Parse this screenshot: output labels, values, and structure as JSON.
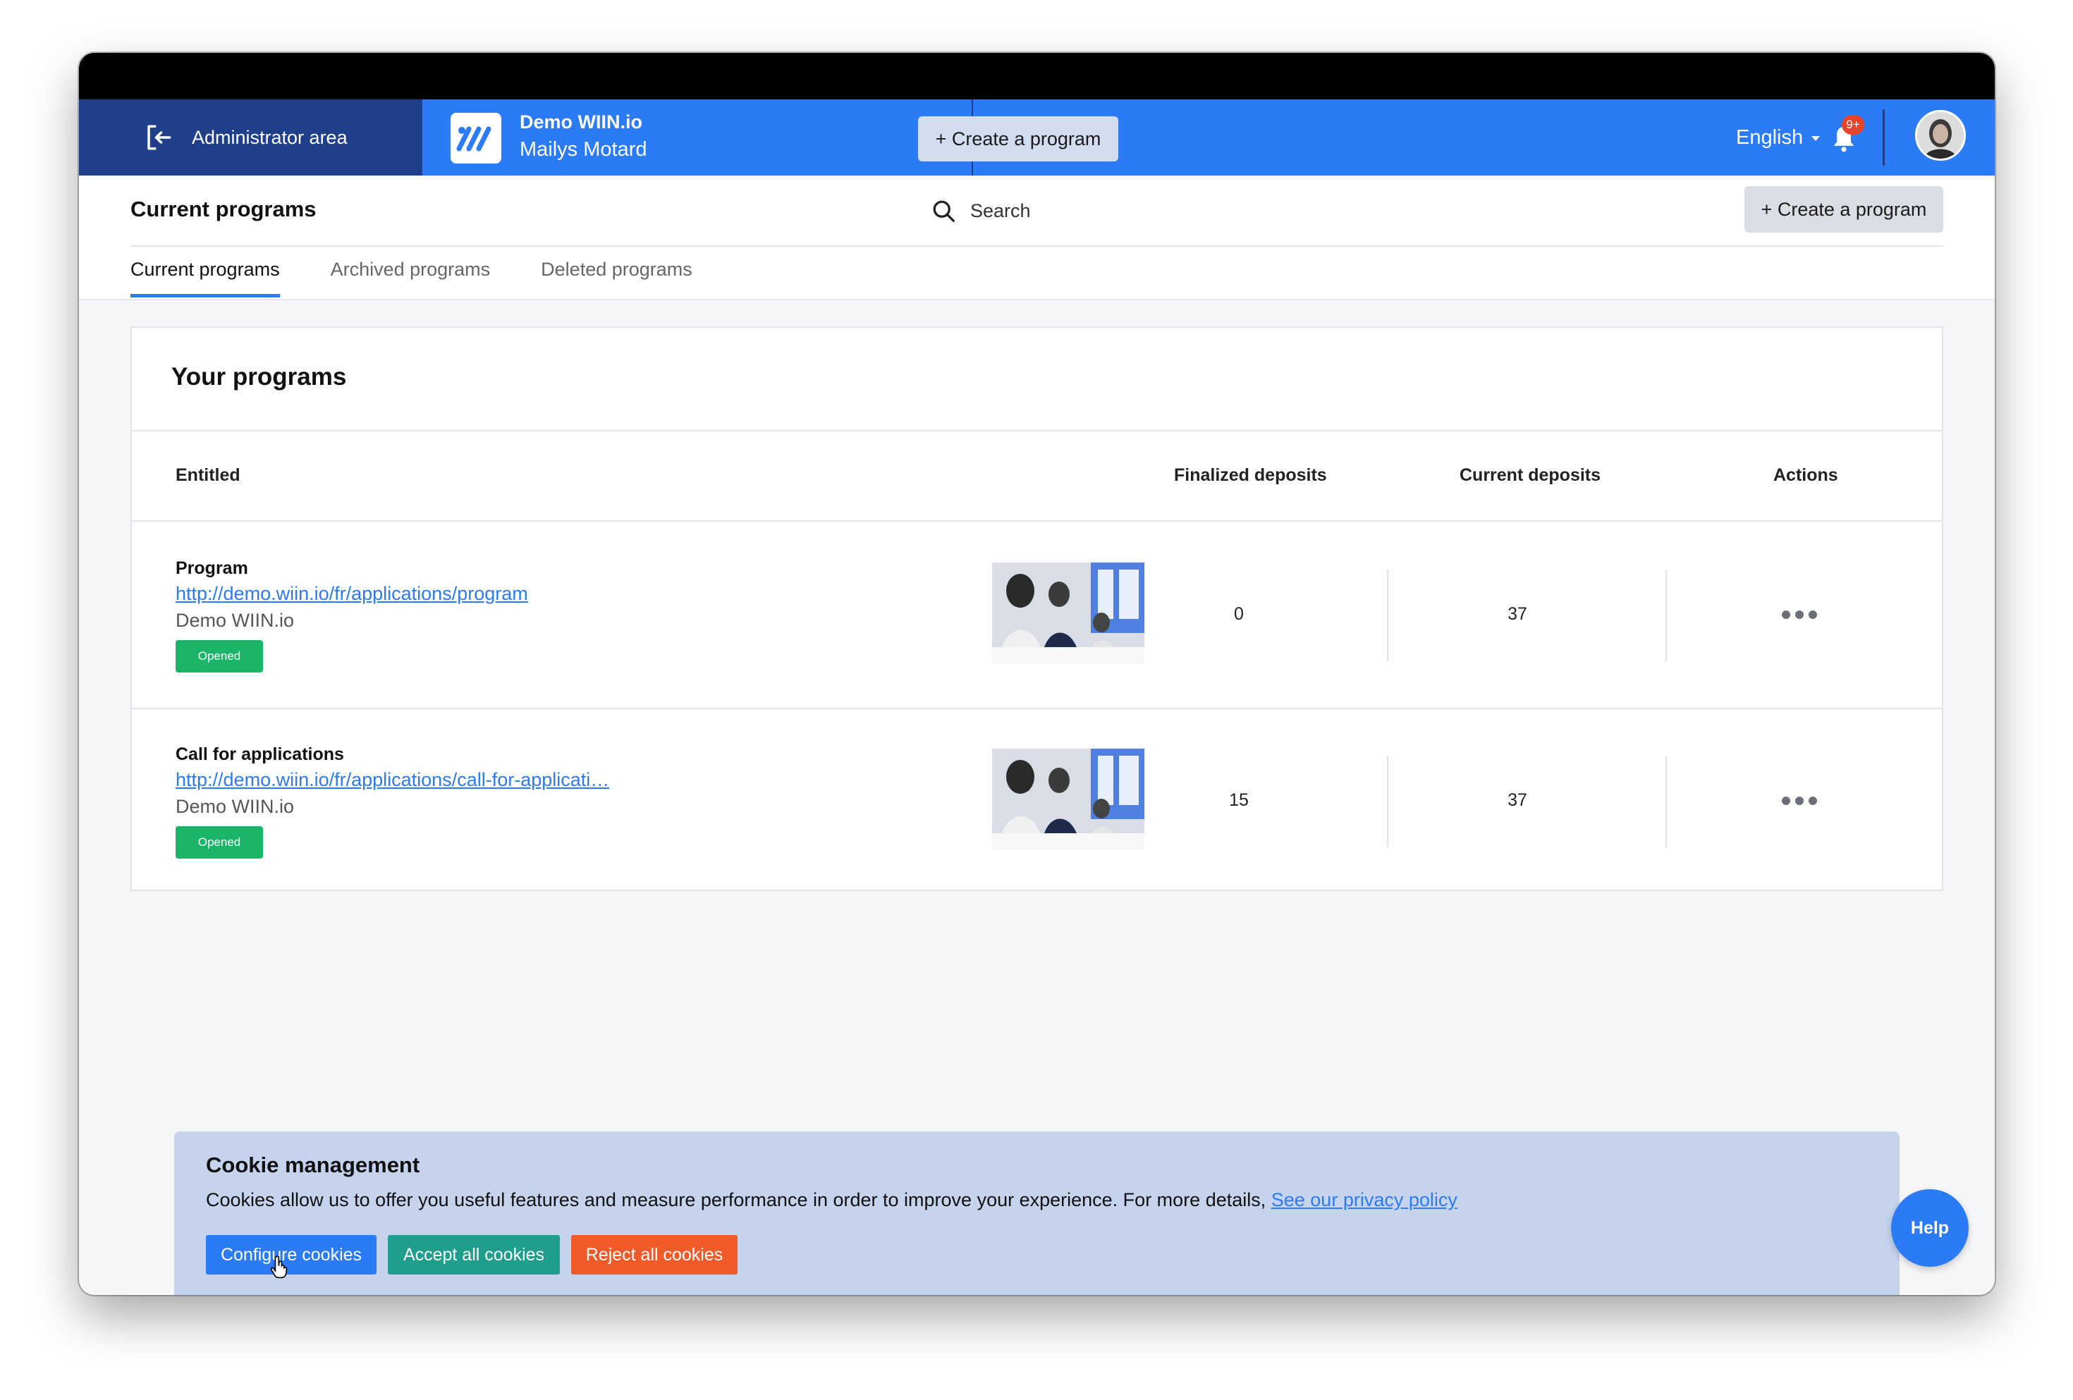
{
  "topnav": {
    "admin_label": "Administrator area",
    "org_name": "Demo WIIN.io",
    "org_user": "Mailys Motard",
    "create_label": "+ Create a program",
    "language": "English",
    "notification_count": "9+",
    "icons": [
      "exit-icon",
      "wiin-logo",
      "chevron-down-icon",
      "bell-icon",
      "avatar"
    ]
  },
  "subheader": {
    "title": "Current programs",
    "search_placeholder": "Search",
    "create_label": "+ Create a program",
    "tabs": [
      {
        "label": "Current programs",
        "active": true
      },
      {
        "label": "Archived programs",
        "active": false
      },
      {
        "label": "Deleted programs",
        "active": false
      }
    ]
  },
  "programs": {
    "title": "Your programs",
    "columns": {
      "entitled": "Entitled",
      "finalized": "Finalized deposits",
      "current": "Current deposits",
      "actions": "Actions"
    },
    "rows": [
      {
        "name": "Program",
        "link": "http://demo.wiin.io/fr/applications/program",
        "org": "Demo WIIN.io",
        "status": "Opened",
        "finalized": "0",
        "current": "37"
      },
      {
        "name": "Call for applications",
        "link": "http://demo.wiin.io/fr/applications/call-for-applicati…",
        "org": "Demo WIIN.io",
        "status": "Opened",
        "finalized": "15",
        "current": "37"
      }
    ]
  },
  "cookie": {
    "title": "Cookie management",
    "text": "Cookies allow us to offer you useful features and measure performance in order to improve your experience. For more details, ",
    "policy_link": "See our privacy policy",
    "configure": "Configure cookies",
    "accept": "Accept all cookies",
    "reject": "Reject all cookies"
  },
  "help_label": "Help",
  "colors": {
    "primary": "#2b7bf6",
    "admin_bg": "#1f3f8a",
    "opened": "#1bb56a",
    "accept": "#1f9e8b",
    "reject": "#ee5a28"
  }
}
